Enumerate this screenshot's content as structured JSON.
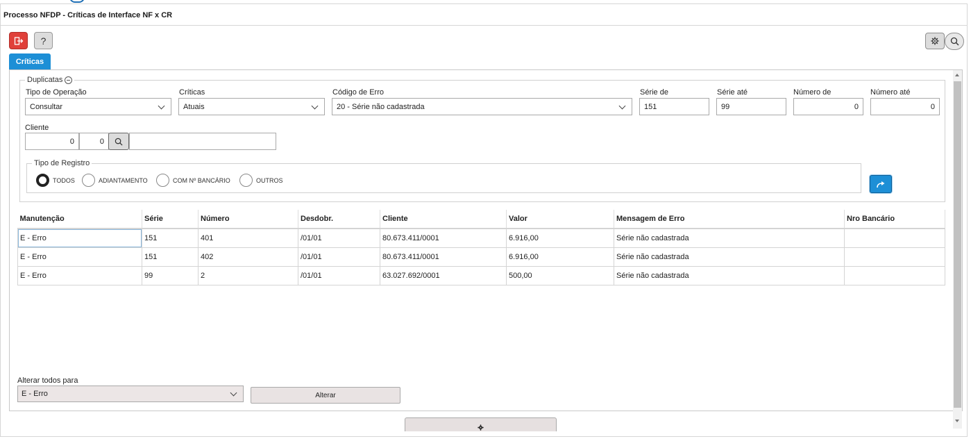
{
  "window": {
    "title": "Processo NFDP - Críticas de Interface NF x CR"
  },
  "toolbar": {
    "help_label": "?"
  },
  "tabs": [
    {
      "label": "Críticas"
    }
  ],
  "filters": {
    "legend": "Duplicatas",
    "tipo_operacao": {
      "label": "Tipo de Operação",
      "value": "Consultar"
    },
    "criticas": {
      "label": "Críticas",
      "value": "Atuais"
    },
    "codigo_erro": {
      "label": "Código de Erro",
      "value": "20 - Série não cadastrada"
    },
    "serie_de": {
      "label": "Série de",
      "value": "151"
    },
    "serie_ate": {
      "label": "Série até",
      "value": "99"
    },
    "numero_de": {
      "label": "Número de",
      "value": "0"
    },
    "numero_ate": {
      "label": "Número até",
      "value": "0"
    },
    "cliente": {
      "label": "Cliente",
      "code1": "0",
      "code2": "0",
      "name": ""
    },
    "tipo_registro": {
      "legend": "Tipo de Registro",
      "options": [
        "TODOS",
        "ADIANTAMENTO",
        "COM Nº BANCÁRIO",
        "OUTROS"
      ],
      "selected": "TODOS"
    }
  },
  "grid": {
    "columns": [
      "Manutenção",
      "Série",
      "Número",
      "Desdobr.",
      "Cliente",
      "Valor",
      "Mensagem de Erro",
      "Nro Bancário"
    ],
    "rows": [
      [
        "E - Erro",
        "151",
        "401",
        "/01/01",
        "80.673.411/0001",
        "6.916,00",
        "Série não cadastrada",
        ""
      ],
      [
        "E - Erro",
        "151",
        "402",
        "/01/01",
        "80.673.411/0001",
        "6.916,00",
        "Série não cadastrada",
        ""
      ],
      [
        "E - Erro",
        "99",
        "2",
        "/01/01",
        "63.027.692/0001",
        "500,00",
        "Série não cadastrada",
        ""
      ]
    ]
  },
  "bulk": {
    "label": "Alterar todos para",
    "value": "E - Erro",
    "button_label": "Alterar"
  },
  "icons": {
    "exit": "exit-icon",
    "help": "help-icon",
    "settings": "gear-icon",
    "search": "search-icon",
    "go": "forward-arrow-icon",
    "bottom": "gear-icon"
  },
  "colors": {
    "accent": "#1d8fd6",
    "danger": "#e0403a"
  }
}
